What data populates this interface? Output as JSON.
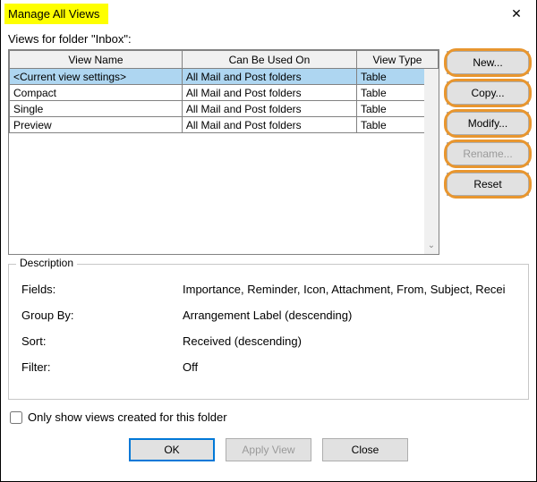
{
  "dialog": {
    "title": "Manage All Views",
    "folderLabel": "Views for folder \"Inbox\":"
  },
  "table": {
    "headers": {
      "name": "View Name",
      "usedOn": "Can Be Used On",
      "type": "View Type"
    },
    "rows": [
      {
        "name": "<Current view settings>",
        "usedOn": "All Mail and Post folders",
        "type": "Table",
        "selected": true
      },
      {
        "name": "Compact",
        "usedOn": "All Mail and Post folders",
        "type": "Table",
        "selected": false
      },
      {
        "name": "Single",
        "usedOn": "All Mail and Post folders",
        "type": "Table",
        "selected": false
      },
      {
        "name": "Preview",
        "usedOn": "All Mail and Post folders",
        "type": "Table",
        "selected": false
      }
    ]
  },
  "sideButtons": {
    "new": "New...",
    "copy": "Copy...",
    "modify": "Modify...",
    "rename": "Rename...",
    "reset": "Reset"
  },
  "description": {
    "legend": "Description",
    "fieldsLabel": "Fields:",
    "fieldsValue": "Importance, Reminder, Icon, Attachment, From, Subject, Recei",
    "groupByLabel": "Group By:",
    "groupByValue": "Arrangement Label (descending)",
    "sortLabel": "Sort:",
    "sortValue": "Received (descending)",
    "filterLabel": "Filter:",
    "filterValue": "Off"
  },
  "checkbox": {
    "label": "Only show views created for this folder",
    "checked": false
  },
  "bottom": {
    "ok": "OK",
    "apply": "Apply View",
    "close": "Close"
  }
}
